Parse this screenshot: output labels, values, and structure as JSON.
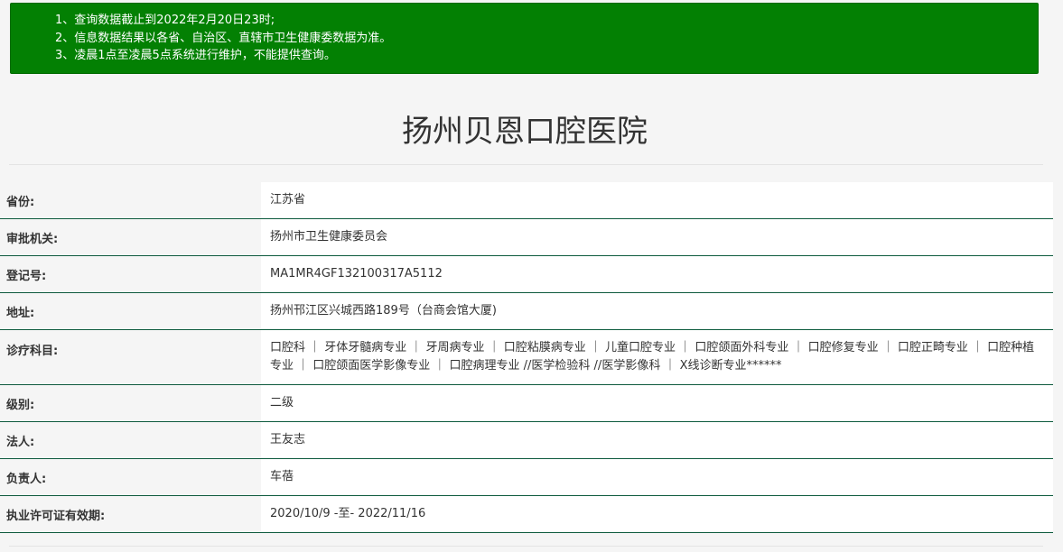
{
  "notice": {
    "lines": [
      "1、查询数据截止到2022年2月20日23时;",
      "2、信息数据结果以各省、自治区、直辖市卫生健康委数据为准。",
      "3、凌晨1点至凌晨5点系统进行维护，不能提供查询。"
    ]
  },
  "title": "扬州贝恩口腔医院",
  "rows": [
    {
      "label": "省份:",
      "value": "江苏省"
    },
    {
      "label": "审批机关:",
      "value": "扬州市卫生健康委员会"
    },
    {
      "label": "登记号:",
      "value": "MA1MR4GF132100317A5112"
    },
    {
      "label": "地址:",
      "value": "扬州邗江区兴城西路189号（台商会馆大厦)"
    },
    {
      "label": "诊疗科目:",
      "value": "口腔科 ｜ 牙体牙髓病专业 ｜ 牙周病专业 ｜ 口腔粘膜病专业 ｜ 儿童口腔专业 ｜ 口腔颌面外科专业 ｜ 口腔修复专业 ｜ 口腔正畸专业 ｜ 口腔种植专业 ｜ 口腔颌面医学影像专业 ｜ 口腔病理专业 //医学检验科 //医学影像科 ｜ X线诊断专业******"
    },
    {
      "label": "级别:",
      "value": "二级"
    },
    {
      "label": "法人:",
      "value": "王友志"
    },
    {
      "label": "负责人:",
      "value": "车蓓"
    },
    {
      "label": "执业许可证有效期:",
      "value": "2020/10/9 -至- 2022/11/16"
    }
  ]
}
